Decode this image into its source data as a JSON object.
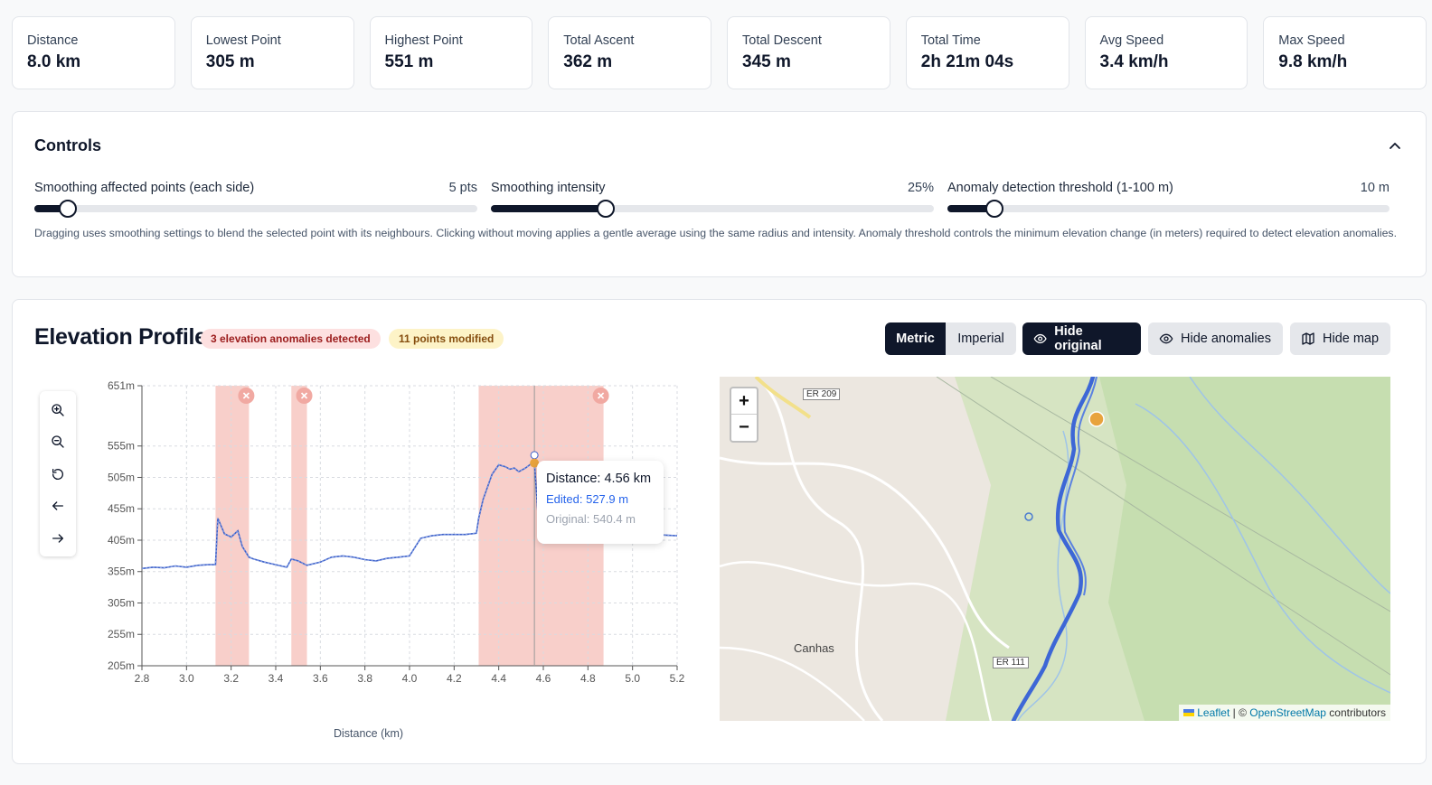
{
  "stats": [
    {
      "label": "Distance",
      "value": "8.0 km"
    },
    {
      "label": "Lowest Point",
      "value": "305 m"
    },
    {
      "label": "Highest Point",
      "value": "551 m"
    },
    {
      "label": "Total Ascent",
      "value": "362 m"
    },
    {
      "label": "Total Descent",
      "value": "345 m"
    },
    {
      "label": "Total Time",
      "value": "2h 21m 04s"
    },
    {
      "label": "Avg Speed",
      "value": "3.4 km/h"
    },
    {
      "label": "Max Speed",
      "value": "9.8 km/h"
    }
  ],
  "controls": {
    "title": "Controls",
    "sliders": [
      {
        "label": "Smoothing affected points (each side)",
        "value": "5 pts",
        "fraction": 0.075
      },
      {
        "label": "Smoothing intensity",
        "value": "25%",
        "fraction": 0.26
      },
      {
        "label": "Anomaly detection threshold (1-100 m)",
        "value": "10 m",
        "fraction": 0.107
      }
    ],
    "help": "Dragging uses smoothing settings to blend the selected point with its neighbours. Clicking without moving applies a gentle average using the same radius and intensity. Anomaly threshold controls the minimum elevation change (in meters) required to detect elevation anomalies."
  },
  "elevation": {
    "title": "Elevation Profile",
    "anomaly_badge": "3 elevation anomalies detected",
    "modified_badge": "11 points modified",
    "buttons": {
      "metric": "Metric",
      "imperial": "Imperial",
      "hide_original": "Hide original",
      "hide_anomalies": "Hide anomalies",
      "hide_map": "Hide map"
    },
    "tooltip": {
      "distance": "Distance: 4.56 km",
      "edited": "Edited: 527.9 m",
      "original": "Original: 540.4 m"
    }
  },
  "map": {
    "labels": {
      "road1": "ER 209",
      "road2": "ER 111",
      "place": "Canhas"
    },
    "attribution": {
      "leaflet": "Leaflet",
      "sep": " | © ",
      "osm": "OpenStreetMap",
      "rest": " contributors"
    }
  },
  "colors": {
    "accent": "#0f172a",
    "line": "#3b5fc9",
    "anomaly": "#f8cfca",
    "marker": "#e8a33d"
  },
  "chart_data": {
    "type": "line",
    "xlabel": "Distance (km)",
    "ylabel": "",
    "xlim": [
      2.8,
      5.2
    ],
    "ylim": [
      205,
      651
    ],
    "x_ticks": [
      2.8,
      3.0,
      3.2,
      3.4,
      3.6,
      3.8,
      4.0,
      4.2,
      4.4,
      4.6,
      4.8,
      5.0,
      5.2
    ],
    "y_ticks": [
      "205m",
      "255m",
      "305m",
      "355m",
      "405m",
      "455m",
      "505m",
      "555m",
      "651m"
    ],
    "y_tick_values": [
      205,
      255,
      305,
      355,
      405,
      455,
      505,
      555,
      651
    ],
    "anomaly_ranges": [
      [
        3.13,
        3.28
      ],
      [
        3.47,
        3.54
      ],
      [
        4.31,
        4.87
      ]
    ],
    "series": [
      {
        "x": [
          2.8,
          2.85,
          2.9,
          2.95,
          3.0,
          3.05,
          3.1,
          3.13,
          3.14,
          3.17,
          3.2,
          3.23,
          3.25,
          3.28,
          3.3,
          3.35,
          3.4,
          3.45,
          3.47,
          3.5,
          3.54,
          3.6,
          3.65,
          3.7,
          3.75,
          3.8,
          3.85,
          3.9,
          3.95,
          4.0,
          4.05,
          4.1,
          4.15,
          4.2,
          4.25,
          4.3,
          4.31,
          4.33,
          4.37,
          4.4,
          4.43,
          4.45,
          4.47,
          4.49,
          4.52,
          4.55,
          4.56,
          4.58,
          4.6,
          4.65,
          4.7,
          4.75,
          4.8,
          4.85,
          4.9,
          4.95,
          5.0,
          5.05,
          5.1,
          5.15,
          5.2
        ],
        "y": [
          360,
          362,
          361,
          364,
          362,
          365,
          366,
          366,
          440,
          415,
          410,
          420,
          395,
          378,
          375,
          370,
          366,
          362,
          375,
          372,
          365,
          370,
          378,
          380,
          378,
          374,
          372,
          376,
          378,
          380,
          408,
          412,
          414,
          414,
          414,
          416,
          440,
          470,
          510,
          525,
          522,
          518,
          520,
          514,
          520,
          528,
          530,
          425,
          418,
          420,
          422,
          420,
          420,
          419,
          418,
          417,
          416,
          415,
          414,
          413,
          412
        ]
      }
    ],
    "cursor_x": 4.56
  }
}
